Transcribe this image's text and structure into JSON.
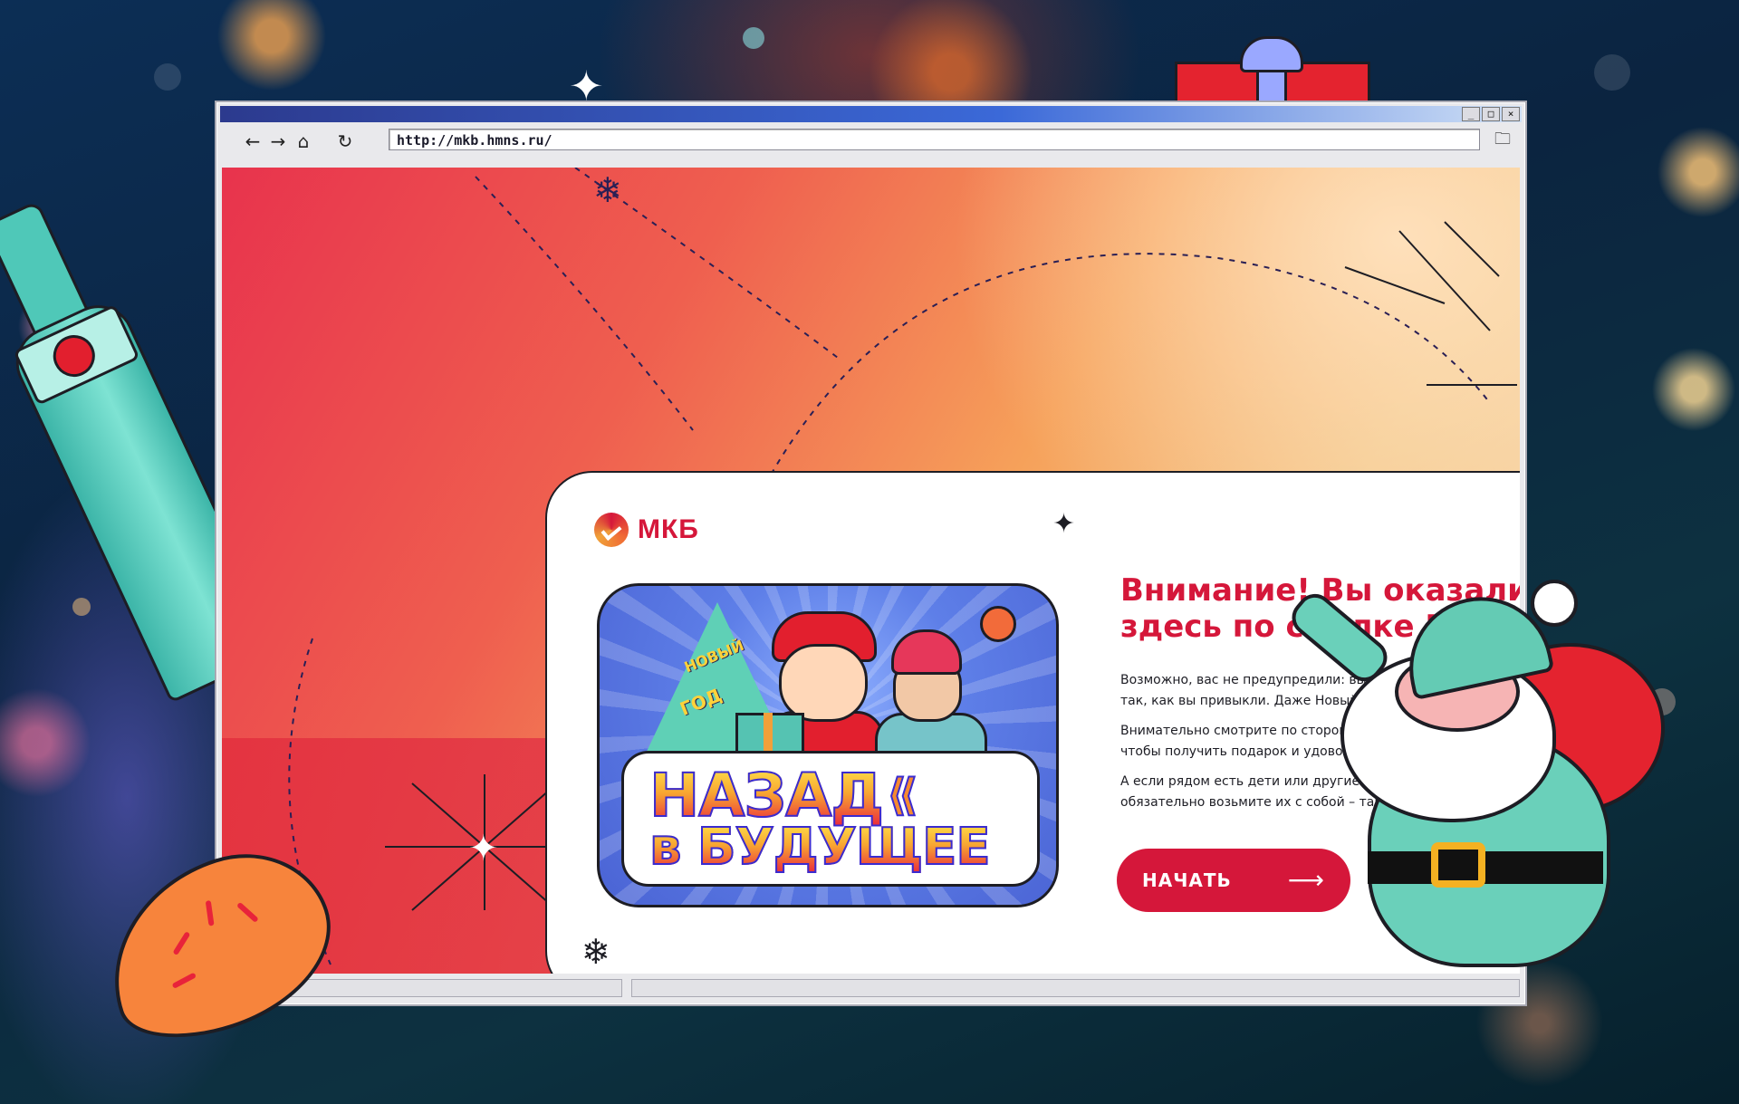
{
  "browser": {
    "window_buttons": [
      "_",
      "□",
      "×"
    ],
    "nav": {
      "back_icon": "←",
      "forward_icon": "→",
      "home_icon": "⌂",
      "reload_icon": "↻",
      "folder_icon": "🗀"
    },
    "url": "http://mkb.hmns.ru/"
  },
  "card": {
    "logo_text": "МКБ",
    "promo": {
      "tree_text_1": "НОВЫЙ",
      "tree_text_2": "ГОД",
      "title_line_1": "НАЗАД",
      "title_line_2": "в БУДУЩЕЕ"
    },
    "heading": "Внимание! Вы оказались здесь по ссылке МКБ.",
    "paragraphs": [
      "Возможно, вас не предупредили: вы в будущем. Здесь всё не так, как вы привыкли. Даже Новый год.",
      "Внимательно смотрите по сторонам и выполняйте задания, чтобы получить подарок и удовольствие от процесса.",
      "А если рядом есть дети или другие приятные люди, обязательно возьмите их с собой – так будет ещё веселее!"
    ],
    "start_button": {
      "label": "НАЧАТЬ",
      "arrow_icon": "⟶"
    }
  },
  "colors": {
    "brand_red": "#d5173a",
    "outline": "#1d1d24"
  }
}
